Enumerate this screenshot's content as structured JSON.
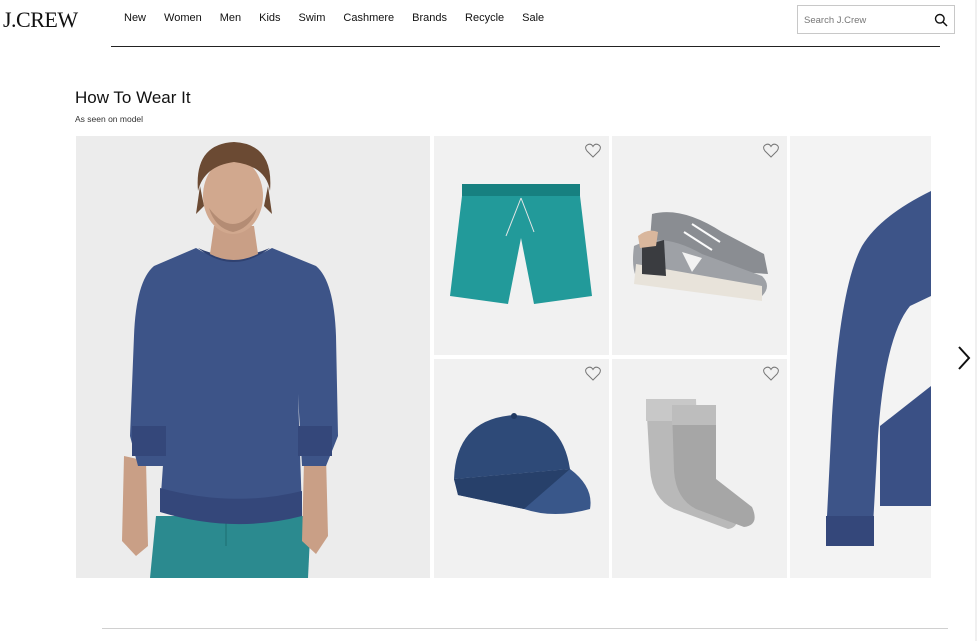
{
  "brand": {
    "logo_text": "J.CREW"
  },
  "nav": {
    "items": [
      {
        "label": "New"
      },
      {
        "label": "Women"
      },
      {
        "label": "Men"
      },
      {
        "label": "Kids"
      },
      {
        "label": "Swim"
      },
      {
        "label": "Cashmere"
      },
      {
        "label": "Brands"
      },
      {
        "label": "Recycle"
      },
      {
        "label": "Sale"
      }
    ]
  },
  "search": {
    "placeholder": "Search J.Crew",
    "icon": "search-icon"
  },
  "section": {
    "title": "How To Wear It",
    "subtitle": "As seen on model"
  },
  "products": [
    {
      "name": "model-look",
      "icon": "hero-model-image"
    },
    {
      "name": "swim-trunks",
      "color": "#1f8a8a",
      "icon": "heart-icon"
    },
    {
      "name": "sneakers",
      "color": "#8a8d92",
      "icon": "heart-icon"
    },
    {
      "name": "baseball-cap",
      "color": "#2e4a78",
      "icon": "heart-icon"
    },
    {
      "name": "socks",
      "color": "#b9b9b9",
      "icon": "heart-icon"
    },
    {
      "name": "sweatshirt-partial",
      "color": "#3d5488"
    }
  ],
  "carousel": {
    "next_icon": "chevron-right-icon"
  },
  "colors": {
    "sweatshirt": "#3d5488",
    "shorts": "#2b8a8f",
    "background": "#ececec"
  }
}
